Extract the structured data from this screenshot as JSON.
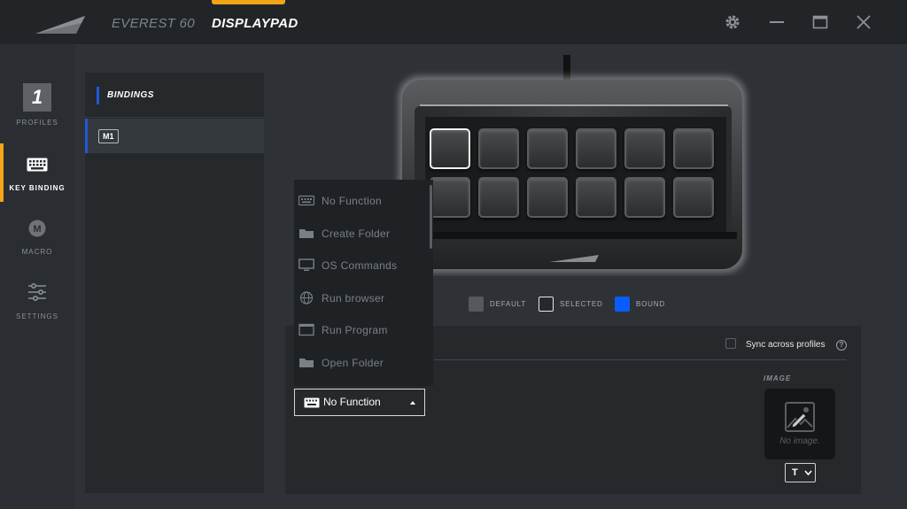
{
  "topbar": {
    "tabs": [
      {
        "label": "EVEREST 60"
      },
      {
        "label": "DISPLAYPAD"
      }
    ],
    "accent_color": "#f2a516"
  },
  "sidebar": {
    "profile_number": "1",
    "items": [
      {
        "label": "PROFILES"
      },
      {
        "label": "KEY BINDING"
      },
      {
        "label": "MACRO",
        "icon_letter": "M"
      },
      {
        "label": "SETTINGS"
      }
    ]
  },
  "bindings": {
    "header": "BINDINGS",
    "selected_item": "M1",
    "accent_color": "#1e58d6"
  },
  "device": {
    "rows": 2,
    "columns": 6,
    "selected_key": 1
  },
  "legend": {
    "default": "DEFAULT",
    "selected": "SELECTED",
    "bound": "BOUND",
    "bound_color": "#0a5cff"
  },
  "function_menu": {
    "items": [
      {
        "label": "No Function",
        "icon": "keyboard-icon"
      },
      {
        "label": "Create Folder",
        "icon": "folder-icon"
      },
      {
        "label": "OS Commands",
        "icon": "monitor-icon"
      },
      {
        "label": "Run browser",
        "icon": "globe-icon"
      },
      {
        "label": "Run Program",
        "icon": "window-icon"
      },
      {
        "label": "Open Folder",
        "icon": "folder-icon"
      }
    ],
    "selected_value": "No Function"
  },
  "config": {
    "sync_label": "Sync across profiles",
    "help": "?",
    "image_title": "IMAGE",
    "no_image": "No image.",
    "text_button": "T"
  }
}
